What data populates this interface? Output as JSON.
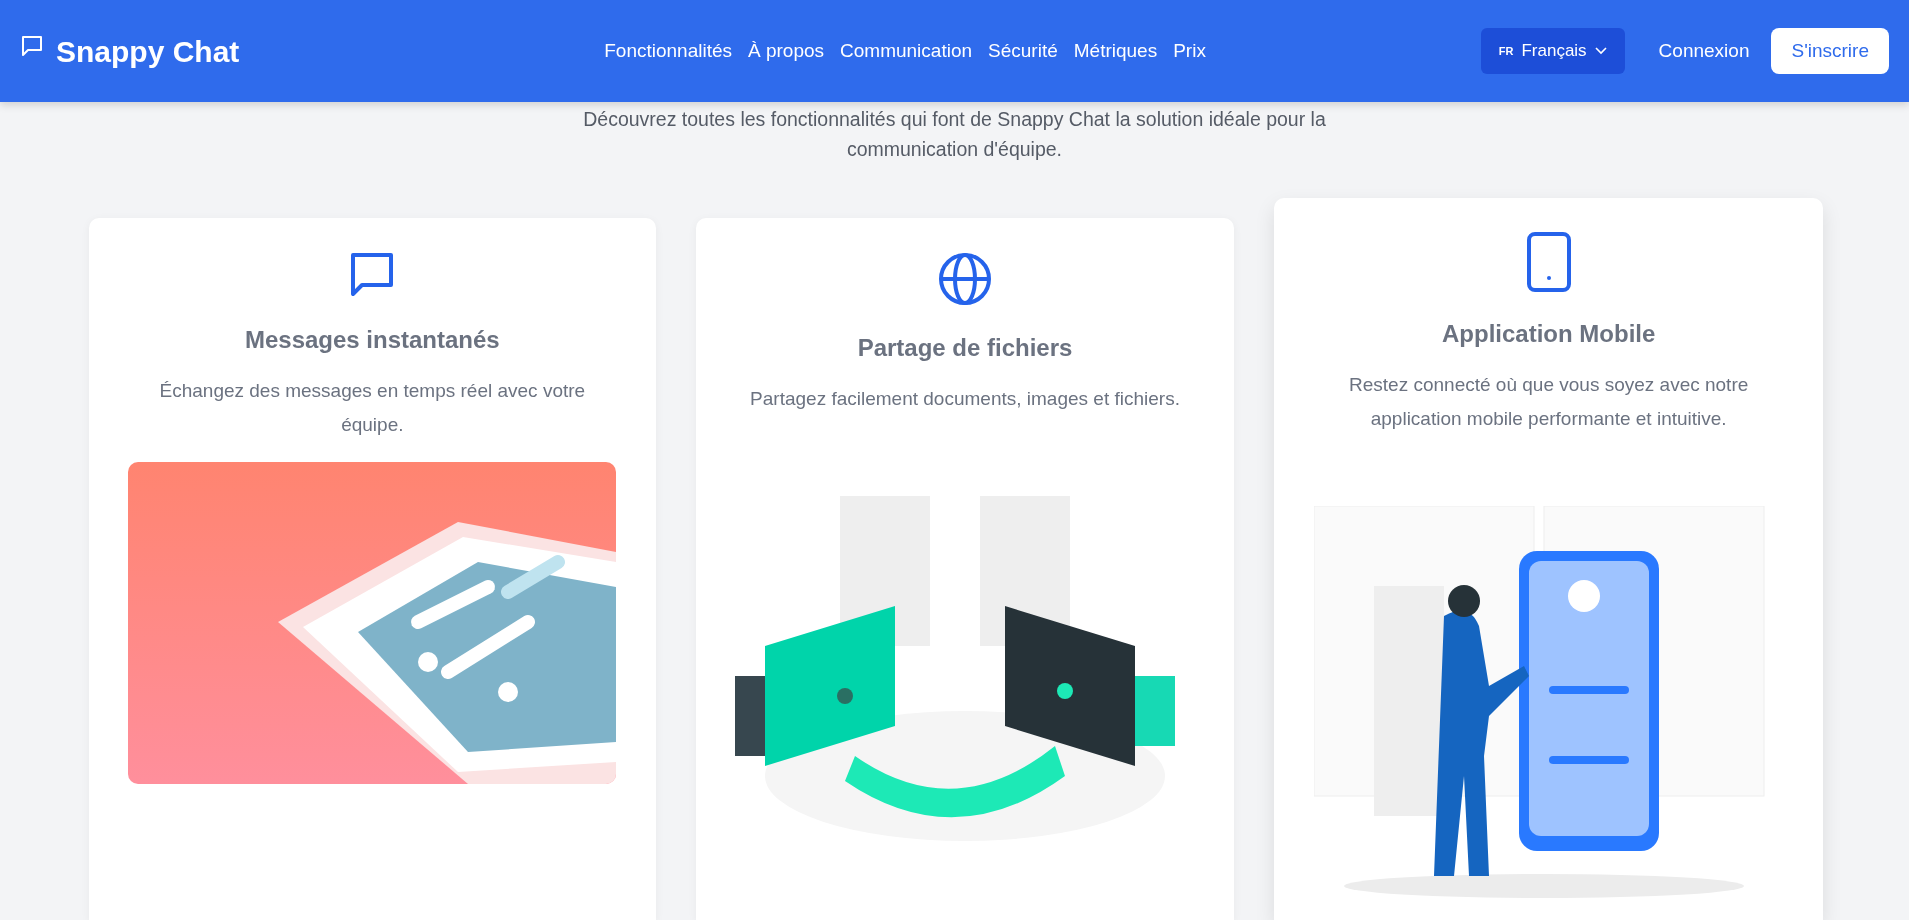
{
  "navbar": {
    "brand": "Snappy Chat",
    "links": [
      {
        "label": "Fonctionnalités"
      },
      {
        "label": "À propos"
      },
      {
        "label": "Communication"
      },
      {
        "label": "Sécurité"
      },
      {
        "label": "Métriques"
      },
      {
        "label": "Prix"
      }
    ],
    "language": {
      "code": "FR",
      "label": "Français"
    },
    "login": "Connexion",
    "signup": "S'inscrire"
  },
  "intro": "Découvrez toutes les fonctionnalités qui font de Snappy Chat la solution idéale pour la communication d'équipe.",
  "features": [
    {
      "title": "Messages instantanés",
      "description": "Échangez des messages en temps réel avec votre équipe.",
      "raised": false
    },
    {
      "title": "Partage de fichiers",
      "description": "Partagez facilement documents, images et fichiers.",
      "raised": false
    },
    {
      "title": "Application Mobile",
      "description": "Restez connecté où que vous soyez avec notre application mobile performante et intuitive.",
      "raised": true
    }
  ]
}
